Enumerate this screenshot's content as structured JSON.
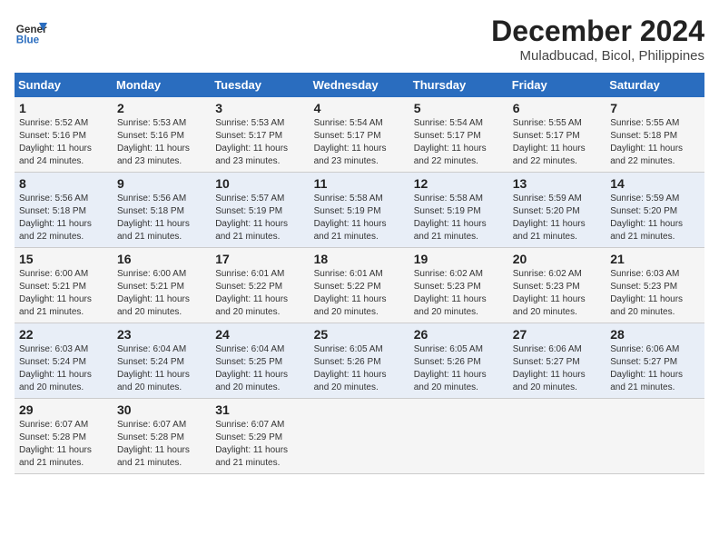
{
  "header": {
    "logo_line1": "General",
    "logo_line2": "Blue",
    "title": "December 2024",
    "subtitle": "Muladbucad, Bicol, Philippines"
  },
  "days_of_week": [
    "Sunday",
    "Monday",
    "Tuesday",
    "Wednesday",
    "Thursday",
    "Friday",
    "Saturday"
  ],
  "weeks": [
    [
      {
        "day": "1",
        "info": "Sunrise: 5:52 AM\nSunset: 5:16 PM\nDaylight: 11 hours\nand 24 minutes."
      },
      {
        "day": "2",
        "info": "Sunrise: 5:53 AM\nSunset: 5:16 PM\nDaylight: 11 hours\nand 23 minutes."
      },
      {
        "day": "3",
        "info": "Sunrise: 5:53 AM\nSunset: 5:17 PM\nDaylight: 11 hours\nand 23 minutes."
      },
      {
        "day": "4",
        "info": "Sunrise: 5:54 AM\nSunset: 5:17 PM\nDaylight: 11 hours\nand 23 minutes."
      },
      {
        "day": "5",
        "info": "Sunrise: 5:54 AM\nSunset: 5:17 PM\nDaylight: 11 hours\nand 22 minutes."
      },
      {
        "day": "6",
        "info": "Sunrise: 5:55 AM\nSunset: 5:17 PM\nDaylight: 11 hours\nand 22 minutes."
      },
      {
        "day": "7",
        "info": "Sunrise: 5:55 AM\nSunset: 5:18 PM\nDaylight: 11 hours\nand 22 minutes."
      }
    ],
    [
      {
        "day": "8",
        "info": "Sunrise: 5:56 AM\nSunset: 5:18 PM\nDaylight: 11 hours\nand 22 minutes."
      },
      {
        "day": "9",
        "info": "Sunrise: 5:56 AM\nSunset: 5:18 PM\nDaylight: 11 hours\nand 21 minutes."
      },
      {
        "day": "10",
        "info": "Sunrise: 5:57 AM\nSunset: 5:19 PM\nDaylight: 11 hours\nand 21 minutes."
      },
      {
        "day": "11",
        "info": "Sunrise: 5:58 AM\nSunset: 5:19 PM\nDaylight: 11 hours\nand 21 minutes."
      },
      {
        "day": "12",
        "info": "Sunrise: 5:58 AM\nSunset: 5:19 PM\nDaylight: 11 hours\nand 21 minutes."
      },
      {
        "day": "13",
        "info": "Sunrise: 5:59 AM\nSunset: 5:20 PM\nDaylight: 11 hours\nand 21 minutes."
      },
      {
        "day": "14",
        "info": "Sunrise: 5:59 AM\nSunset: 5:20 PM\nDaylight: 11 hours\nand 21 minutes."
      }
    ],
    [
      {
        "day": "15",
        "info": "Sunrise: 6:00 AM\nSunset: 5:21 PM\nDaylight: 11 hours\nand 21 minutes."
      },
      {
        "day": "16",
        "info": "Sunrise: 6:00 AM\nSunset: 5:21 PM\nDaylight: 11 hours\nand 20 minutes."
      },
      {
        "day": "17",
        "info": "Sunrise: 6:01 AM\nSunset: 5:22 PM\nDaylight: 11 hours\nand 20 minutes."
      },
      {
        "day": "18",
        "info": "Sunrise: 6:01 AM\nSunset: 5:22 PM\nDaylight: 11 hours\nand 20 minutes."
      },
      {
        "day": "19",
        "info": "Sunrise: 6:02 AM\nSunset: 5:23 PM\nDaylight: 11 hours\nand 20 minutes."
      },
      {
        "day": "20",
        "info": "Sunrise: 6:02 AM\nSunset: 5:23 PM\nDaylight: 11 hours\nand 20 minutes."
      },
      {
        "day": "21",
        "info": "Sunrise: 6:03 AM\nSunset: 5:23 PM\nDaylight: 11 hours\nand 20 minutes."
      }
    ],
    [
      {
        "day": "22",
        "info": "Sunrise: 6:03 AM\nSunset: 5:24 PM\nDaylight: 11 hours\nand 20 minutes."
      },
      {
        "day": "23",
        "info": "Sunrise: 6:04 AM\nSunset: 5:24 PM\nDaylight: 11 hours\nand 20 minutes."
      },
      {
        "day": "24",
        "info": "Sunrise: 6:04 AM\nSunset: 5:25 PM\nDaylight: 11 hours\nand 20 minutes."
      },
      {
        "day": "25",
        "info": "Sunrise: 6:05 AM\nSunset: 5:26 PM\nDaylight: 11 hours\nand 20 minutes."
      },
      {
        "day": "26",
        "info": "Sunrise: 6:05 AM\nSunset: 5:26 PM\nDaylight: 11 hours\nand 20 minutes."
      },
      {
        "day": "27",
        "info": "Sunrise: 6:06 AM\nSunset: 5:27 PM\nDaylight: 11 hours\nand 20 minutes."
      },
      {
        "day": "28",
        "info": "Sunrise: 6:06 AM\nSunset: 5:27 PM\nDaylight: 11 hours\nand 21 minutes."
      }
    ],
    [
      {
        "day": "29",
        "info": "Sunrise: 6:07 AM\nSunset: 5:28 PM\nDaylight: 11 hours\nand 21 minutes."
      },
      {
        "day": "30",
        "info": "Sunrise: 6:07 AM\nSunset: 5:28 PM\nDaylight: 11 hours\nand 21 minutes."
      },
      {
        "day": "31",
        "info": "Sunrise: 6:07 AM\nSunset: 5:29 PM\nDaylight: 11 hours\nand 21 minutes."
      },
      null,
      null,
      null,
      null
    ]
  ]
}
